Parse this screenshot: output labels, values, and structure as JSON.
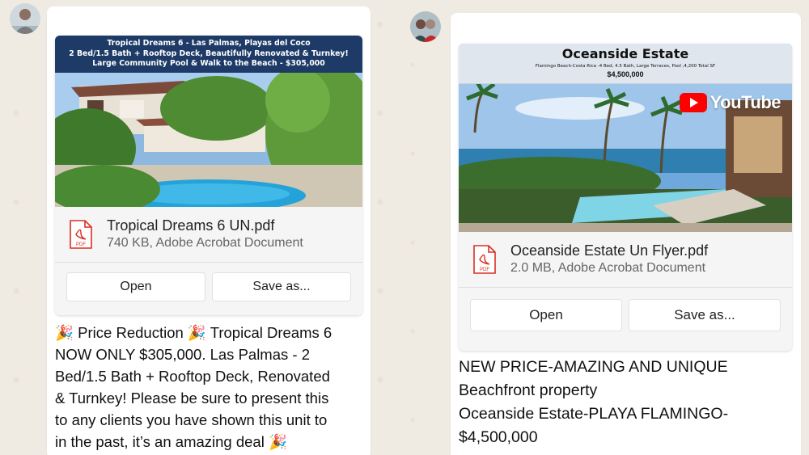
{
  "colors": {
    "chat_background": "#efeae2",
    "bubble": "#ffffff",
    "banner_navy": "#1e3b67",
    "pdf_red": "#d93025",
    "youtube_red": "#ff0000"
  },
  "messages": [
    {
      "attachment": {
        "preview_banner": [
          "Tropical Dreams 6 - Las Palmas, Playas del Coco",
          "2 Bed/1.5 Bath + Rooftop Deck, Beautifully Renovated & Turnkey!",
          "Large Community Pool & Walk to the Beach - $305,000"
        ],
        "file_icon": "pdf-icon",
        "file_name": "Tropical Dreams 6 UN.pdf",
        "file_meta": "740 KB, Adobe Acrobat Document",
        "open_label": "Open",
        "save_label": "Save as..."
      },
      "text_lines": [
        "🎉 Price Reduction 🎉 Tropical Dreams 6",
        "NOW ONLY $305,000. Las Palmas - 2",
        "Bed/1.5 Bath + Rooftop Deck, Renovated",
        "& Turnkey! Please be sure to present this",
        "to any clients you have shown this unit to",
        "in the past, it’s an amazing deal 🎉"
      ]
    },
    {
      "attachment": {
        "preview_title": "Oceanside Estate",
        "preview_subtitle": "Flamingo Beach-Costa Rica -4 Bed, 4.5 Bath, Large Terraces, Pool ,4,200 Total SF",
        "preview_price": "$4,500,000",
        "youtube_label": "YouTube",
        "file_icon": "pdf-icon",
        "file_name": "Oceanside Estate Un Flyer.pdf",
        "file_meta": "2.0 MB, Adobe Acrobat Document",
        "open_label": "Open",
        "save_label": "Save as..."
      },
      "text_lines": [
        "NEW PRICE-AMAZING AND UNIQUE",
        "Beachfront property",
        "Oceanside Estate-PLAYA FLAMINGO-",
        "$4,500,000"
      ]
    }
  ]
}
